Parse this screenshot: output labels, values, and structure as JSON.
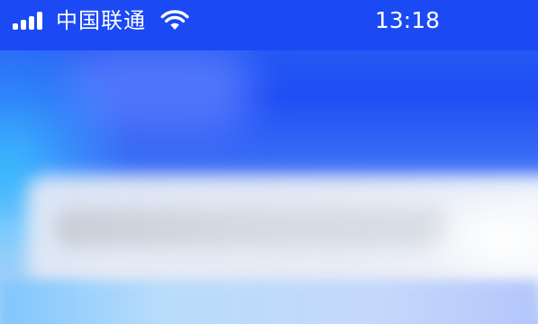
{
  "status_bar": {
    "carrier": "中国联通",
    "time": "13:18",
    "signal_icon": "cellular-signal-icon",
    "wifi_icon": "wifi-icon",
    "background_color": "#1b49f3",
    "text_color": "#ffffff"
  },
  "background": {
    "description_colors": [
      "#1f4ef4",
      "#3d70f6",
      "#e6ecf5",
      "#7fc6fb"
    ]
  }
}
